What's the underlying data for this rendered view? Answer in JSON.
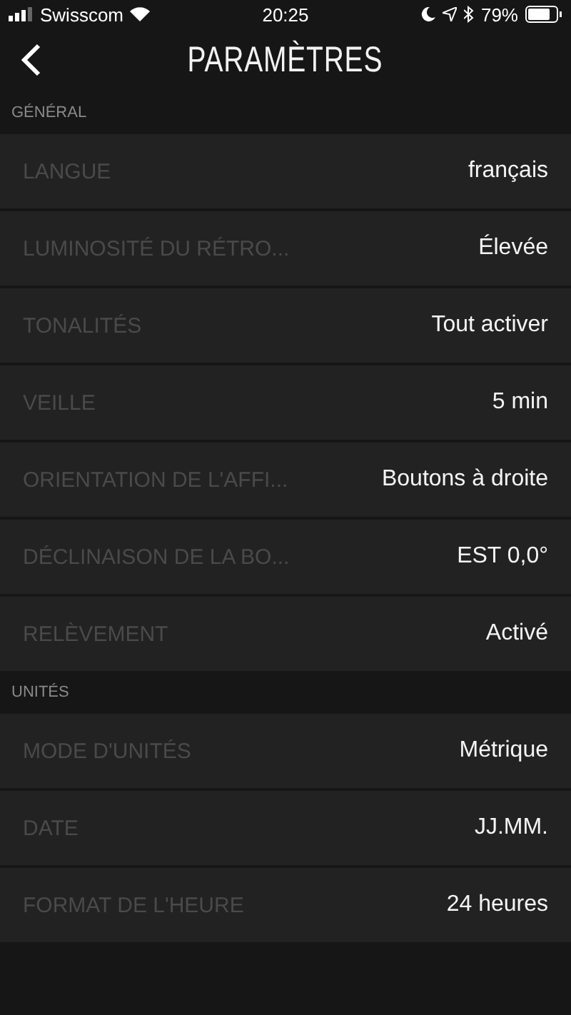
{
  "status_bar": {
    "carrier": "Swisscom",
    "time": "20:25",
    "battery": "79%"
  },
  "nav": {
    "title": "PARAMÈTRES"
  },
  "sections": [
    {
      "title": "GÉNÉRAL",
      "rows": [
        {
          "label": "LANGUE",
          "value": "français"
        },
        {
          "label": "LUMINOSITÉ DU RÉTRO...",
          "value": "Élevée"
        },
        {
          "label": "TONALITÉS",
          "value": "Tout activer"
        },
        {
          "label": "VEILLE",
          "value": "5 min"
        },
        {
          "label": "ORIENTATION DE L'AFFI...",
          "value": "Boutons à droite"
        },
        {
          "label": "DÉCLINAISON DE LA BO...",
          "value": "EST 0,0°"
        },
        {
          "label": "RELÈVEMENT",
          "value": "Activé"
        }
      ]
    },
    {
      "title": "UNITÉS",
      "rows": [
        {
          "label": "MODE D'UNITÉS",
          "value": "Métrique"
        },
        {
          "label": "DATE",
          "value": "JJ.MM."
        },
        {
          "label": "FORMAT DE L'HEURE",
          "value": "24 heures"
        }
      ]
    }
  ]
}
